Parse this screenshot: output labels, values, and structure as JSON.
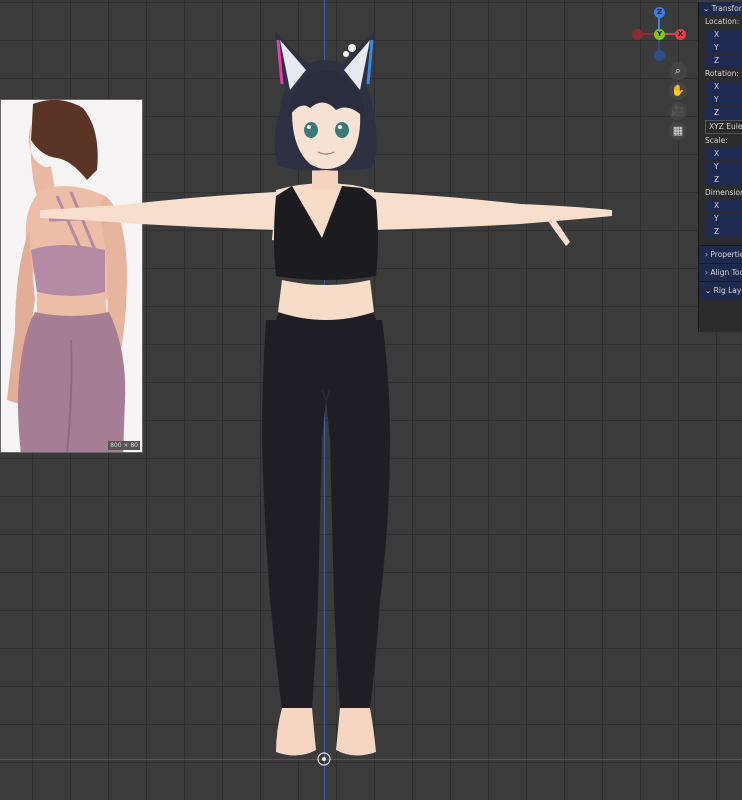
{
  "reference_image": {
    "size_label": "800 × 80"
  },
  "gizmo": {
    "z": "Z",
    "y": "Y",
    "x": "X"
  },
  "toolbar": {
    "zoom_icon": "magnify-icon",
    "pan_icon": "hand-icon",
    "camera_icon": "camera-icon",
    "grid_icon": "grid-icon"
  },
  "sidebar": {
    "transform_header": "Transform",
    "location_label": "Location:",
    "location_x": "X",
    "location_y": "Y",
    "location_z": "Z",
    "rotation_label": "Rotation:",
    "rotation_x": "X",
    "rotation_y": "Y",
    "rotation_z": "Z",
    "rotation_mode": "XYZ Euler",
    "scale_label": "Scale:",
    "scale_x": "X",
    "scale_y": "Y",
    "scale_z": "Z",
    "dimensions_label": "Dimensions:",
    "dim_x": "X",
    "dim_y": "Y",
    "dim_z": "Z",
    "properties_header": "Properties",
    "align_tools_header": "Align Tools",
    "rig_layers_header": "Rig Layers"
  },
  "colors": {
    "grid_bg": "#3b3b3b",
    "z_axis": "#3f5fa8",
    "x_axis": "#8a3a48",
    "gizmo_x": "#e0404a",
    "gizmo_y": "#7fc31b",
    "gizmo_z": "#3a7ee0",
    "panel_accent": "#1f2a52"
  }
}
